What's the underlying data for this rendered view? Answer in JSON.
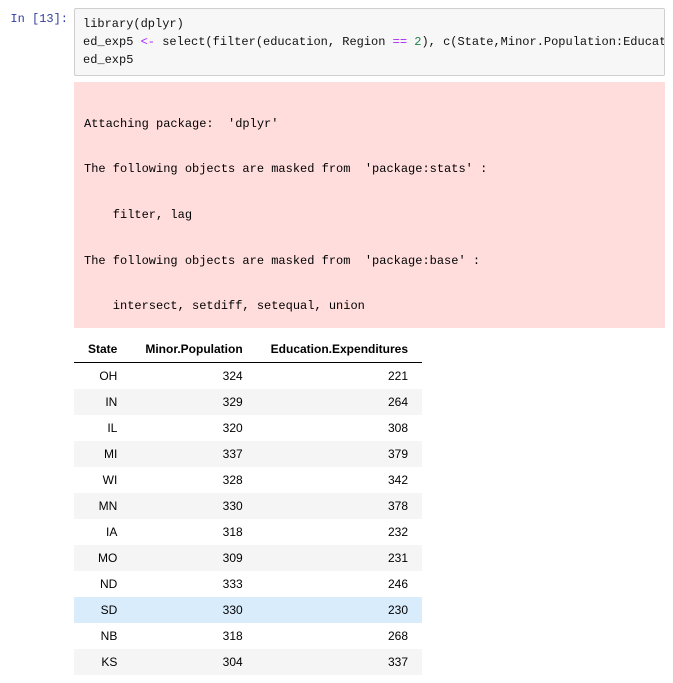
{
  "cell": {
    "prompt_label": "In [13]:",
    "code": {
      "line1_pre": "library(dplyr)",
      "line2_pre": "ed_exp5 ",
      "line2_arrow": "<-",
      "line2_mid": " select(filter(education, Region ",
      "line2_eq": "==",
      "line2_sp": " ",
      "line2_num": "2",
      "line2_post": "), c(State,Minor.Population:Education.Expenditures))",
      "line3_pre": "ed_exp5"
    },
    "stderr": "\nAttaching package:  'dplyr'\n\nThe following objects are masked from  'package:stats' :\n\n    filter, lag\n\nThe following objects are masked from  'package:base' :\n\n    intersect, setdiff, setequal, union\n"
  },
  "chart_data": {
    "type": "table",
    "columns": [
      "State",
      "Minor.Population",
      "Education.Expenditures"
    ],
    "rows": [
      {
        "State": "OH",
        "Minor.Population": 324,
        "Education.Expenditures": 221
      },
      {
        "State": "IN",
        "Minor.Population": 329,
        "Education.Expenditures": 264
      },
      {
        "State": "IL",
        "Minor.Population": 320,
        "Education.Expenditures": 308
      },
      {
        "State": "MI",
        "Minor.Population": 337,
        "Education.Expenditures": 379
      },
      {
        "State": "WI",
        "Minor.Population": 328,
        "Education.Expenditures": 342
      },
      {
        "State": "MN",
        "Minor.Population": 330,
        "Education.Expenditures": 378
      },
      {
        "State": "IA",
        "Minor.Population": 318,
        "Education.Expenditures": 232
      },
      {
        "State": "MO",
        "Minor.Population": 309,
        "Education.Expenditures": 231
      },
      {
        "State": "ND",
        "Minor.Population": 333,
        "Education.Expenditures": 246
      },
      {
        "State": "SD",
        "Minor.Population": 330,
        "Education.Expenditures": 230
      },
      {
        "State": "NB",
        "Minor.Population": 318,
        "Education.Expenditures": 268
      },
      {
        "State": "KS",
        "Minor.Population": 304,
        "Education.Expenditures": 337
      }
    ],
    "highlight_row_index": 9
  }
}
